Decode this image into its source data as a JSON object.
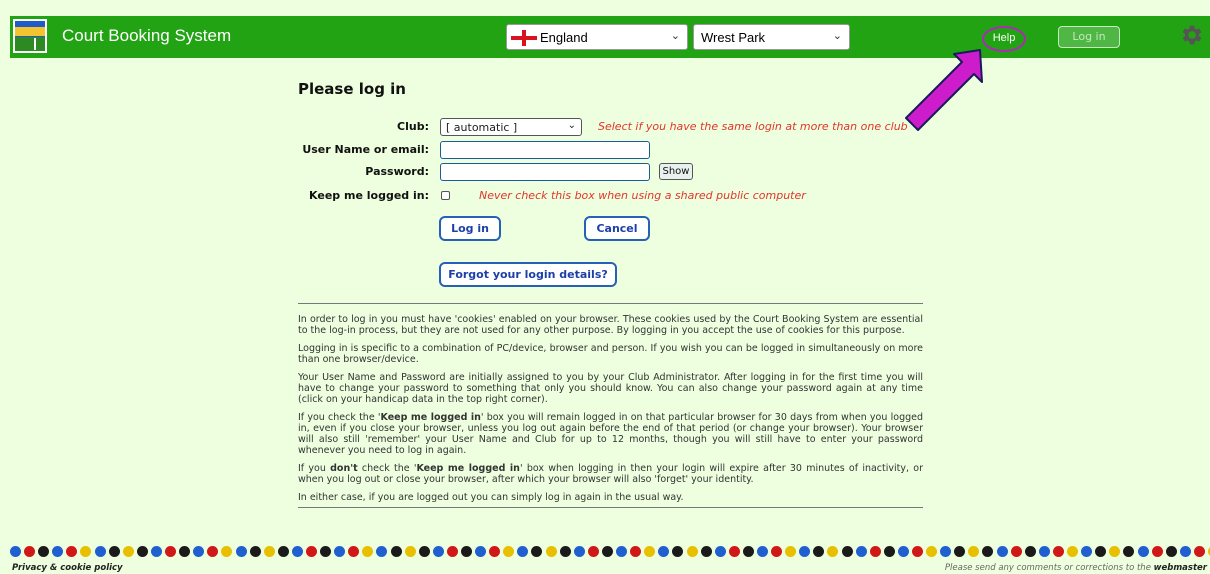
{
  "header": {
    "app_title": "Court Booking System",
    "country": "England",
    "club": "Wrest Park",
    "help_label": "Help",
    "login_label": "Log in",
    "colors": {
      "bar": "#22a314",
      "page": "#eeffdf",
      "accent": "#b028b8"
    }
  },
  "form": {
    "title": "Please log in",
    "club_label": "Club:",
    "club_value": "[ automatic ]",
    "club_hint": "Select if you have the same login at more than one club",
    "username_label": "User Name or email:",
    "username_value": "",
    "password_label": "Password:",
    "password_value": "",
    "show_label": "Show",
    "keep_label": "Keep me logged in:",
    "keep_checked": false,
    "keep_hint": "Never check this box when using a shared public computer",
    "login_label": "Log in",
    "cancel_label": "Cancel",
    "forgot_label": "Forgot your login details?"
  },
  "info": {
    "p1": "In order to log in you must have 'cookies' enabled on your browser. These cookies used by the Court Booking System are essential to the log-in process, but they are not used for any other purpose. By logging in you accept the use of cookies for this purpose.",
    "p2": "Logging in is specific to a combination of PC/device, browser and person. If you wish you can be logged in simultaneously on more than one browser/device.",
    "p3": "Your User Name and Password are initially assigned to you by your Club Administrator. After logging in for the first time you will have to change your password to something that only you should know. You can also change your password again at any time (click on your handicap data in the top right corner).",
    "p4_a": "If you check the '",
    "p4_b": "Keep me logged in",
    "p4_c": "' box you will remain logged in on that particular browser for 30 days from when you logged in, even if you close your browser, unless you log out again before the end of that period (or change your browser). Your browser will also still 'remember' your User Name and Club for up to 12 months, though you will still have to enter your password whenever you need to log in again.",
    "p5_a": "If you ",
    "p5_b": "don't",
    "p5_c": " check the '",
    "p5_d": "Keep me logged in",
    "p5_e": "' box when logging in then your login will expire after 30 minutes of inactivity, or when you log out or close your browser, after which your browser will also 'forget' your identity.",
    "p6": "In either case, if you are logged out you can simply log in again in the usual way."
  },
  "footer": {
    "privacy_label": "Privacy & cookie policy",
    "note_prefix": "Please send any comments or corrections to the ",
    "note_link": "webmaster",
    "dot_colors": [
      "#1f5fd0",
      "#d01818",
      "#1a1a1a",
      "#1f5fd0",
      "#d01818",
      "#e8c000",
      "#1f5fd0",
      "#1a1a1a",
      "#e8c000",
      "#1a1a1a"
    ]
  }
}
